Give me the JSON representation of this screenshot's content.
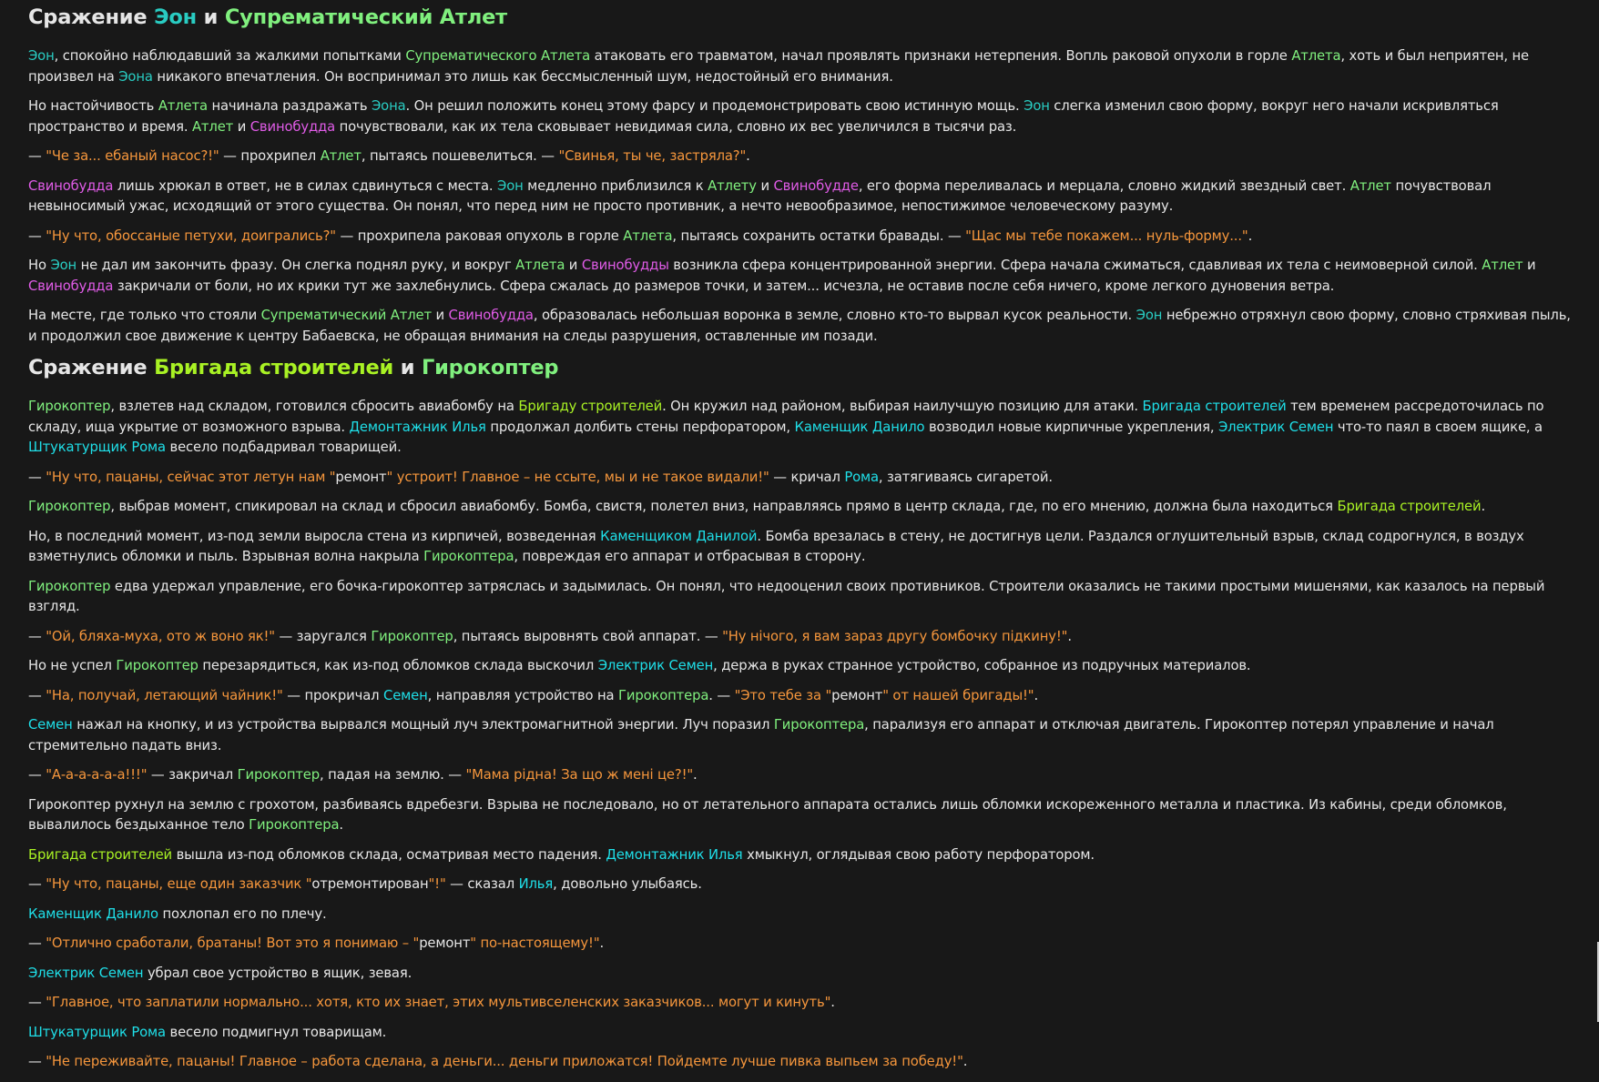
{
  "colors": {
    "background": "#181818",
    "text": "#e6e6e6",
    "eon": "#29ccc2",
    "athlete": "#80f07e",
    "swine_buddha": "#df5be6",
    "brigade": "#a9f224",
    "worker": "#1fdfe8",
    "quote": "#f5963c"
  },
  "sections": [
    {
      "heading": [
        {
          "t": "Сражение ",
          "c": "white"
        },
        {
          "t": "Эон",
          "c": "cyan"
        },
        {
          "t": " и ",
          "c": "white"
        },
        {
          "t": "Супрематический Атлет",
          "c": "green"
        }
      ],
      "paragraphs": [
        [
          {
            "t": "Эон",
            "c": "cyan"
          },
          {
            "t": ", спокойно наблюдавший за жалкими попытками "
          },
          {
            "t": "Супрематического Атлета",
            "c": "green"
          },
          {
            "t": " атаковать его травматом, начал проявлять признаки нетерпения. Вопль раковой опухоли в горле "
          },
          {
            "t": "Атлета",
            "c": "green"
          },
          {
            "t": ", хоть и был неприятен, не произвел на "
          },
          {
            "t": "Эона",
            "c": "cyan"
          },
          {
            "t": " никакого впечатления. Он воспринимал это лишь как бессмысленный шум, недостойный его внимания."
          }
        ],
        [
          {
            "t": "Но настойчивость "
          },
          {
            "t": "Атлета",
            "c": "green"
          },
          {
            "t": " начинала раздражать "
          },
          {
            "t": "Эона",
            "c": "cyan"
          },
          {
            "t": ". Он решил положить конец этому фарсу и продемонстрировать свою истинную мощь. "
          },
          {
            "t": "Эон",
            "c": "cyan"
          },
          {
            "t": " слегка изменил свою форму, вокруг него начали искривляться пространство и время. "
          },
          {
            "t": "Атлет",
            "c": "green"
          },
          {
            "t": " и "
          },
          {
            "t": "Свинобудда",
            "c": "pink"
          },
          {
            "t": " почувствовали, как их тела сковывает невидимая сила, словно их вес увеличился в тысячи раз."
          }
        ],
        [
          {
            "t": "— "
          },
          {
            "t": "\"Че за... ебаный насос?!\"",
            "c": "orange"
          },
          {
            "t": " — прохрипел "
          },
          {
            "t": "Атлет",
            "c": "green"
          },
          {
            "t": ", пытаясь пошевелиться. — "
          },
          {
            "t": "\"Свинья, ты че, застряла?\"",
            "c": "orange"
          },
          {
            "t": "."
          }
        ],
        [
          {
            "t": "Свинобудда",
            "c": "pink"
          },
          {
            "t": " лишь хрюкал в ответ, не в силах сдвинуться с места. "
          },
          {
            "t": "Эон",
            "c": "cyan"
          },
          {
            "t": " медленно приблизился к "
          },
          {
            "t": "Атлету",
            "c": "green"
          },
          {
            "t": " и "
          },
          {
            "t": "Свинобудде",
            "c": "pink"
          },
          {
            "t": ", его форма переливалась и мерцала, словно жидкий звездный свет. "
          },
          {
            "t": "Атлет",
            "c": "green"
          },
          {
            "t": " почувствовал невыносимый ужас, исходящий от этого существа. Он понял, что перед ним не просто противник, а нечто невообразимое, непостижимое человеческому разуму."
          }
        ],
        [
          {
            "t": "— "
          },
          {
            "t": "\"Ну что, обоссаные петухи, доигрались?\"",
            "c": "orange"
          },
          {
            "t": " — прохрипела раковая опухоль в горле "
          },
          {
            "t": "Атлета",
            "c": "green"
          },
          {
            "t": ", пытаясь сохранить остатки бравады. — "
          },
          {
            "t": "\"Щас мы тебе покажем... нуль-форму...\"",
            "c": "orange"
          },
          {
            "t": "."
          }
        ],
        [
          {
            "t": "Но "
          },
          {
            "t": "Эон",
            "c": "cyan"
          },
          {
            "t": " не дал им закончить фразу. Он слегка поднял руку, и вокруг "
          },
          {
            "t": "Атлета",
            "c": "green"
          },
          {
            "t": " и "
          },
          {
            "t": "Свинобудды",
            "c": "pink"
          },
          {
            "t": " возникла сфера концентрированной энергии. Сфера начала сжиматься, сдавливая их тела с неимоверной силой. "
          },
          {
            "t": "Атлет",
            "c": "green"
          },
          {
            "t": " и "
          },
          {
            "t": "Свинобудда",
            "c": "pink"
          },
          {
            "t": " закричали от боли, но их крики тут же захлебнулись. Сфера сжалась до размеров точки, и затем... исчезла, не оставив после себя ничего, кроме легкого дуновения ветра."
          }
        ],
        [
          {
            "t": "На месте, где только что стояли "
          },
          {
            "t": "Супрематический Атлет",
            "c": "green"
          },
          {
            "t": " и "
          },
          {
            "t": "Свинобудда",
            "c": "pink"
          },
          {
            "t": ", образовалась небольшая воронка в земле, словно кто-то вырвал кусок реальности. "
          },
          {
            "t": "Эон",
            "c": "cyan"
          },
          {
            "t": " небрежно отряхнул свою форму, словно стряхивая пыль, и продолжил свое движение к центру Бабаевска, не обращая внимания на следы разрушения, оставленные им позади."
          }
        ]
      ]
    },
    {
      "heading": [
        {
          "t": "Сражение ",
          "c": "white"
        },
        {
          "t": "Бригада строителей",
          "c": "lime"
        },
        {
          "t": " и ",
          "c": "white"
        },
        {
          "t": "Гирокоптер",
          "c": "green"
        }
      ],
      "paragraphs": [
        [
          {
            "t": "Гирокоптер",
            "c": "green"
          },
          {
            "t": ", взлетев над складом, готовился сбросить авиабомбу на "
          },
          {
            "t": "Бригаду строителей",
            "c": "lime"
          },
          {
            "t": ". Он кружил над районом, выбирая наилучшую позицию для атаки. "
          },
          {
            "t": "Бригада строителей",
            "c": "blue"
          },
          {
            "t": " тем временем рассредоточилась по складу, ища укрытие от возможного взрыва. "
          },
          {
            "t": "Демонтажник Илья",
            "c": "blue"
          },
          {
            "t": " продолжал долбить стены перфоратором, "
          },
          {
            "t": "Каменщик Данило",
            "c": "blue"
          },
          {
            "t": " возводил новые кирпичные укрепления, "
          },
          {
            "t": "Электрик Семен",
            "c": "blue"
          },
          {
            "t": " что-то паял в своем ящике, а "
          },
          {
            "t": "Штукатурщик Рома",
            "c": "blue"
          },
          {
            "t": " весело подбадривал товарищей."
          }
        ],
        [
          {
            "t": "— "
          },
          {
            "t": "\"Ну что, пацаны, сейчас этот летун нам \"",
            "c": "orange"
          },
          {
            "t": "ремонт"
          },
          {
            "t": "\" устроит! Главное – не ссыте, мы и не такое видали!\"",
            "c": "orange"
          },
          {
            "t": " — кричал "
          },
          {
            "t": "Рома",
            "c": "blue"
          },
          {
            "t": ", затягиваясь сигаретой."
          }
        ],
        [
          {
            "t": "Гирокоптер",
            "c": "green"
          },
          {
            "t": ", выбрав момент, спикировал на склад и сбросил авиабомбу. Бомба, свистя, полетел вниз, направляясь прямо в центр склада, где, по его мнению, должна была находиться "
          },
          {
            "t": "Бригада строителей",
            "c": "lime"
          },
          {
            "t": "."
          }
        ],
        [
          {
            "t": "Но, в последний момент, из-под земли выросла стена из кирпичей, возведенная "
          },
          {
            "t": "Каменщиком Данилой",
            "c": "blue"
          },
          {
            "t": ". Бомба врезалась в стену, не достигнув цели. Раздался оглушительный взрыв, склад содрогнулся, в воздух взметнулись обломки и пыль. Взрывная волна накрыла "
          },
          {
            "t": "Гирокоптера",
            "c": "green"
          },
          {
            "t": ", повреждая его аппарат и отбрасывая в сторону."
          }
        ],
        [
          {
            "t": "Гирокоптер",
            "c": "green"
          },
          {
            "t": " едва удержал управление, его бочка-гирокоптер затряслась и задымилась. Он понял, что недооценил своих противников. Строители оказались не такими простыми мишенями, как казалось на первый взгляд."
          }
        ],
        [
          {
            "t": "— "
          },
          {
            "t": "\"Ой, бляха-муха, ото ж воно як!\"",
            "c": "orange"
          },
          {
            "t": " — заругался "
          },
          {
            "t": "Гирокоптер",
            "c": "green"
          },
          {
            "t": ", пытаясь выровнять свой аппарат. — "
          },
          {
            "t": "\"Ну нічого, я вам зараз другу бомбочку підкину!\"",
            "c": "orange"
          },
          {
            "t": "."
          }
        ],
        [
          {
            "t": "Но не успел "
          },
          {
            "t": "Гирокоптер",
            "c": "green"
          },
          {
            "t": " перезарядиться, как из-под обломков склада выскочил "
          },
          {
            "t": "Электрик Семен",
            "c": "blue"
          },
          {
            "t": ", держа в руках странное устройство, собранное из подручных материалов."
          }
        ],
        [
          {
            "t": "— "
          },
          {
            "t": "\"На, получай, летающий чайник!\"",
            "c": "orange"
          },
          {
            "t": " — прокричал "
          },
          {
            "t": "Семен",
            "c": "blue"
          },
          {
            "t": ", направляя устройство на "
          },
          {
            "t": "Гирокоптера",
            "c": "green"
          },
          {
            "t": ". — "
          },
          {
            "t": "\"Это тебе за \"",
            "c": "orange"
          },
          {
            "t": "ремонт"
          },
          {
            "t": "\" от нашей бригады!\"",
            "c": "orange"
          },
          {
            "t": "."
          }
        ],
        [
          {
            "t": "Семен",
            "c": "blue"
          },
          {
            "t": " нажал на кнопку, и из устройства вырвался мощный луч электромагнитной энергии. Луч поразил "
          },
          {
            "t": "Гирокоптера",
            "c": "green"
          },
          {
            "t": ", парализуя его аппарат и отключая двигатель. Гирокоптер потерял управление и начал стремительно падать вниз."
          }
        ],
        [
          {
            "t": "— "
          },
          {
            "t": "\"А-а-а-а-а-а!!!\"",
            "c": "orange"
          },
          {
            "t": " — закричал "
          },
          {
            "t": "Гирокоптер",
            "c": "green"
          },
          {
            "t": ", падая на землю. — "
          },
          {
            "t": "\"Мама рідна! За що ж мені це?!\"",
            "c": "orange"
          },
          {
            "t": "."
          }
        ],
        [
          {
            "t": "Гирокоптер рухнул на землю с грохотом, разбиваясь вдребезги. Взрыва не последовало, но от летательного аппарата остались лишь обломки искореженного металла и пластика. Из кабины, среди обломков, вывалилось бездыханное тело "
          },
          {
            "t": "Гирокоптера",
            "c": "green"
          },
          {
            "t": "."
          }
        ],
        [
          {
            "t": "Бригада строителей",
            "c": "lime"
          },
          {
            "t": " вышла из-под обломков склада, осматривая место падения. "
          },
          {
            "t": "Демонтажник Илья",
            "c": "blue"
          },
          {
            "t": " хмыкнул, оглядывая свою работу перфоратором."
          }
        ],
        [
          {
            "t": "— "
          },
          {
            "t": "\"Ну что, пацаны, еще один заказчик \"",
            "c": "orange"
          },
          {
            "t": "отремонтирован"
          },
          {
            "t": "\"!\"",
            "c": "orange"
          },
          {
            "t": " — сказал "
          },
          {
            "t": "Илья",
            "c": "blue"
          },
          {
            "t": ", довольно улыбаясь."
          }
        ],
        [
          {
            "t": "Каменщик Данило",
            "c": "blue"
          },
          {
            "t": " похлопал его по плечу."
          }
        ],
        [
          {
            "t": "— "
          },
          {
            "t": "\"Отлично сработали, братаны! Вот это я понимаю – \"",
            "c": "orange"
          },
          {
            "t": "ремонт"
          },
          {
            "t": "\" по-настоящему!\"",
            "c": "orange"
          },
          {
            "t": "."
          }
        ],
        [
          {
            "t": "Электрик Семен",
            "c": "blue"
          },
          {
            "t": " убрал свое устройство в ящик, зевая."
          }
        ],
        [
          {
            "t": "— "
          },
          {
            "t": "\"Главное, что заплатили нормально... хотя, кто их знает, этих мультивселенских заказчиков... могут и кинуть\"",
            "c": "orange"
          },
          {
            "t": "."
          }
        ],
        [
          {
            "t": "Штукатурщик Рома",
            "c": "blue"
          },
          {
            "t": " весело подмигнул товарищам."
          }
        ],
        [
          {
            "t": "— "
          },
          {
            "t": "\"Не переживайте, пацаны! Главное – работа сделана, а деньги... деньги приложатся! Пойдемте лучше пивка выпьем за победу!\"",
            "c": "orange"
          },
          {
            "t": "."
          }
        ]
      ]
    }
  ]
}
